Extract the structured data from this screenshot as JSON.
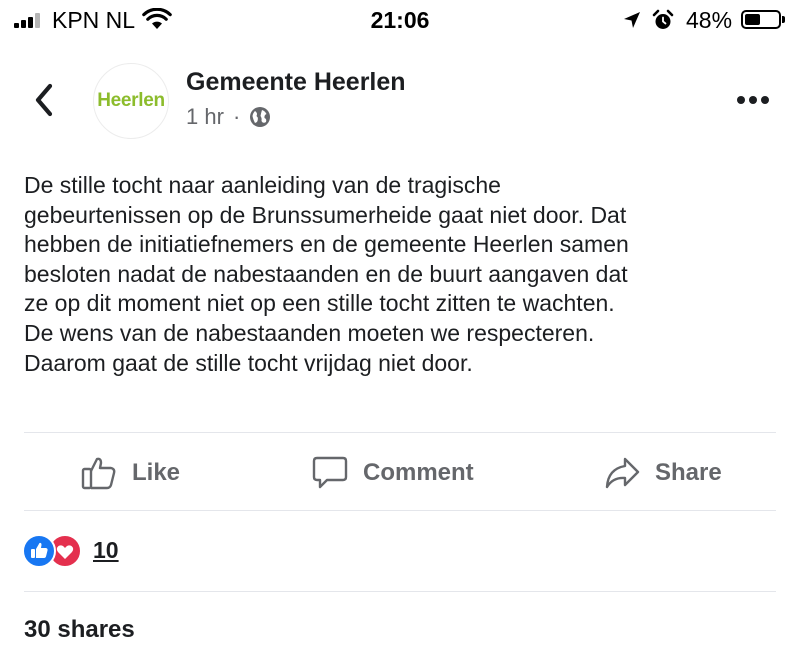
{
  "status_bar": {
    "carrier": "KPN NL",
    "time": "21:06",
    "battery_percent": "48%",
    "battery_level": 0.48,
    "signal_bars": 3,
    "signal_bars_total": 4
  },
  "post": {
    "page_name": "Gemeente Heerlen",
    "avatar_text": "Heerlen",
    "time": "1 hr",
    "separator": "·",
    "audience_icon": "globe-icon",
    "text": "De stille tocht naar aanleiding van de tragische\ngebeurtenissen op de Brunssumerheide gaat niet door. Dat\nhebben de initiatiefnemers en de gemeente Heerlen samen\nbesloten nadat de nabestaanden en de buurt aangaven dat\nze op dit moment niet op een stille tocht zitten te wachten.\nDe wens van de nabestaanden moeten we respecteren.\nDaarom gaat de stille tocht vrijdag niet door."
  },
  "actions": {
    "like": "Like",
    "comment": "Comment",
    "share": "Share"
  },
  "reactions": {
    "icons": [
      "like-reaction-icon",
      "love-reaction-icon"
    ],
    "count": "10"
  },
  "shares": "30 shares",
  "colors": {
    "brand_green": "#8cbc2c",
    "like_blue": "#1877f2",
    "love_red": "#e4304e",
    "muted_text": "#65676b",
    "divider": "#e4e6eb"
  }
}
